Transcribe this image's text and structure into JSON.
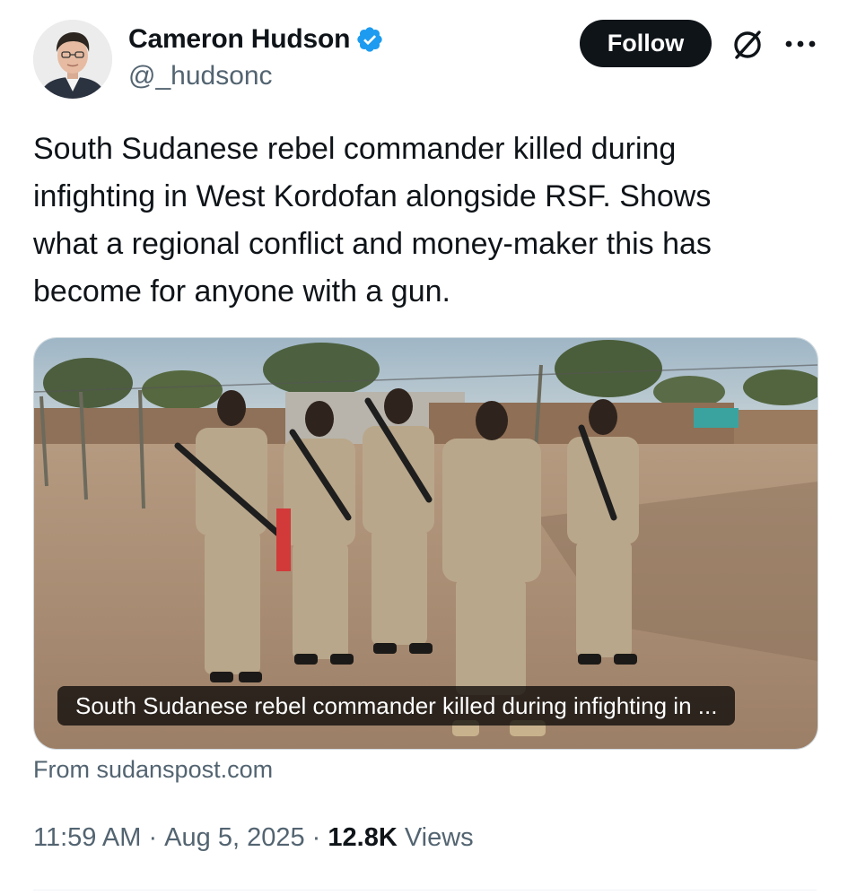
{
  "author": {
    "display_name": "Cameron Hudson",
    "handle": "@_hudsonc",
    "verified": true,
    "verified_color": "#1d9bf0"
  },
  "actions": {
    "follow_label": "Follow",
    "grok_icon": "grok-icon",
    "more_icon": "more-icon"
  },
  "tweet": {
    "text": "South Sudanese rebel commander killed during\ninfighting in West Kordofan alongside RSF.  Shows\nwhat a regional conflict and money-maker this has\nbecome for anyone with a gun."
  },
  "media": {
    "caption": "South Sudanese rebel commander killed during infighting in ...",
    "source_label": "From sudanspost.com"
  },
  "meta": {
    "time": "11:59 AM",
    "separator": " · ",
    "date": "Aug 5, 2025",
    "views_count": "12.8K",
    "views_label": " Views"
  },
  "colors": {
    "text_primary": "#0f1419",
    "text_secondary": "#536471",
    "follow_bg": "#0f1419",
    "follow_text": "#ffffff"
  }
}
